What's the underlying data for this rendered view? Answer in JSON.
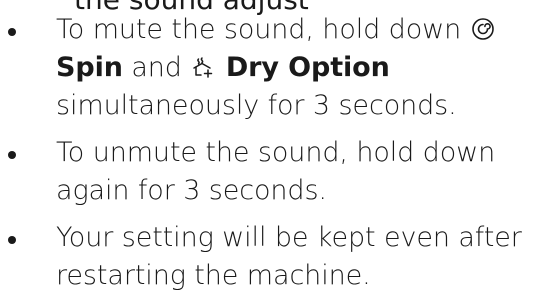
{
  "header_fragment": "the sound adjust",
  "bullets": [
    {
      "part1": "To mute the sound, hold down",
      "spin_icon": "spin-icon",
      "spin_label": "Spin",
      "and_text": "and",
      "dry_icon": "dry-option-icon",
      "dry_label": "Dry Option",
      "part2": "simultaneously for 3 seconds."
    },
    {
      "text": "To unmute the sound, hold down again for 3 seconds."
    },
    {
      "text": "Your setting will be kept even after restarting the machine."
    }
  ]
}
